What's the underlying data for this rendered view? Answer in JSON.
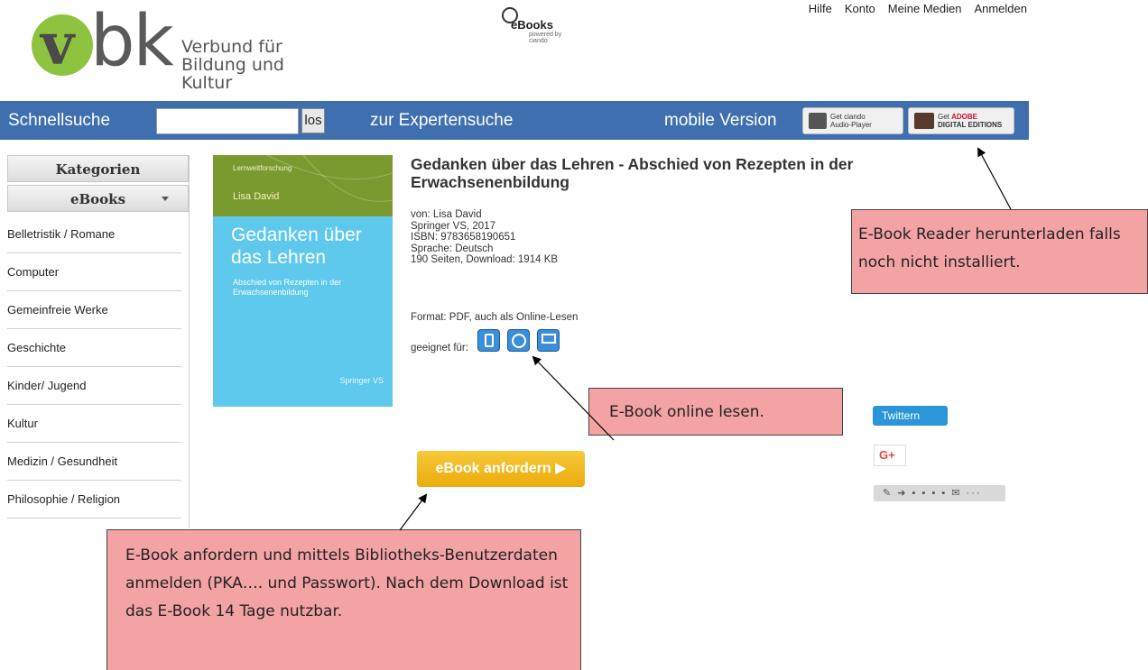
{
  "logo": {
    "big_letters": "v",
    "big_letters2": "bk",
    "line1": "Verbund für",
    "line2": "Bildung und Kultur"
  },
  "ebooks_logo": {
    "name": "eBooks",
    "powered": "powered by ciando"
  },
  "top_links": [
    "Hilfe",
    "Konto",
    "Meine Medien",
    "Anmelden"
  ],
  "navbar": {
    "quick_search": "Schnellsuche",
    "search_value": "",
    "go_button": "los",
    "expert_search": "zur Expertensuche",
    "mobile": "mobile Version",
    "badge_audio": {
      "line1": "Get ciando",
      "line2": "Audio-Player"
    },
    "badge_adobe": {
      "prefix": "Get ",
      "brand": "ADOBE",
      "line2": "DIGITAL EDITIONS"
    }
  },
  "sidebar": {
    "heading": "Kategorien",
    "section": "eBooks",
    "items": [
      "Belletristik / Romane",
      "Computer",
      "Gemeinfreie Werke",
      "Geschichte",
      "Kinder/ Jugend",
      "Kultur",
      "Medizin / Gesundheit",
      "Philosophie / Religion"
    ]
  },
  "cover": {
    "series": "Lernweltforschung",
    "author": "Lisa David",
    "title": "Gedanken über das Lehren",
    "subtitle": "Abschied von Rezepten in der Erwachsenenbildung",
    "publisher": "Springer VS"
  },
  "book": {
    "title": "Gedanken über das Lehren - Abschied von Rezepten in der Erwachsenenbildung",
    "author": "von: Lisa David",
    "publisher_year": "Springer VS, 2017",
    "isbn": "ISBN: 9783658190651",
    "language": "Sprache: Deutsch",
    "pages_download": "190 Seiten, Download: 1914 KB",
    "format": "Format:  PDF, auch als Online-Lesen",
    "suitable": "geeignet für:"
  },
  "order_button": "eBook anfordern  ▶",
  "social": {
    "twitter": "Twittern",
    "gplus": "G+",
    "share": "✎ ➜ ▪ ▪ ▪ ▪ ✉ ···"
  },
  "callouts": {
    "reader": "E-Book Reader herunterladen falls noch nicht installiert.",
    "online": "E-Book online lesen.",
    "order": "E-Book anfordern und mittels Bibliotheks-Benutzerdaten anmelden (PKA…. und Passwort). Nach dem Download ist das E-Book 14 Tage nutzbar."
  },
  "colors": {
    "navbar": "#3f6fae",
    "callout": "#f4a3a4",
    "order_button": "#f0b51d",
    "logo_green": "#8dc33f",
    "device_icon": "#3a8fd8"
  }
}
